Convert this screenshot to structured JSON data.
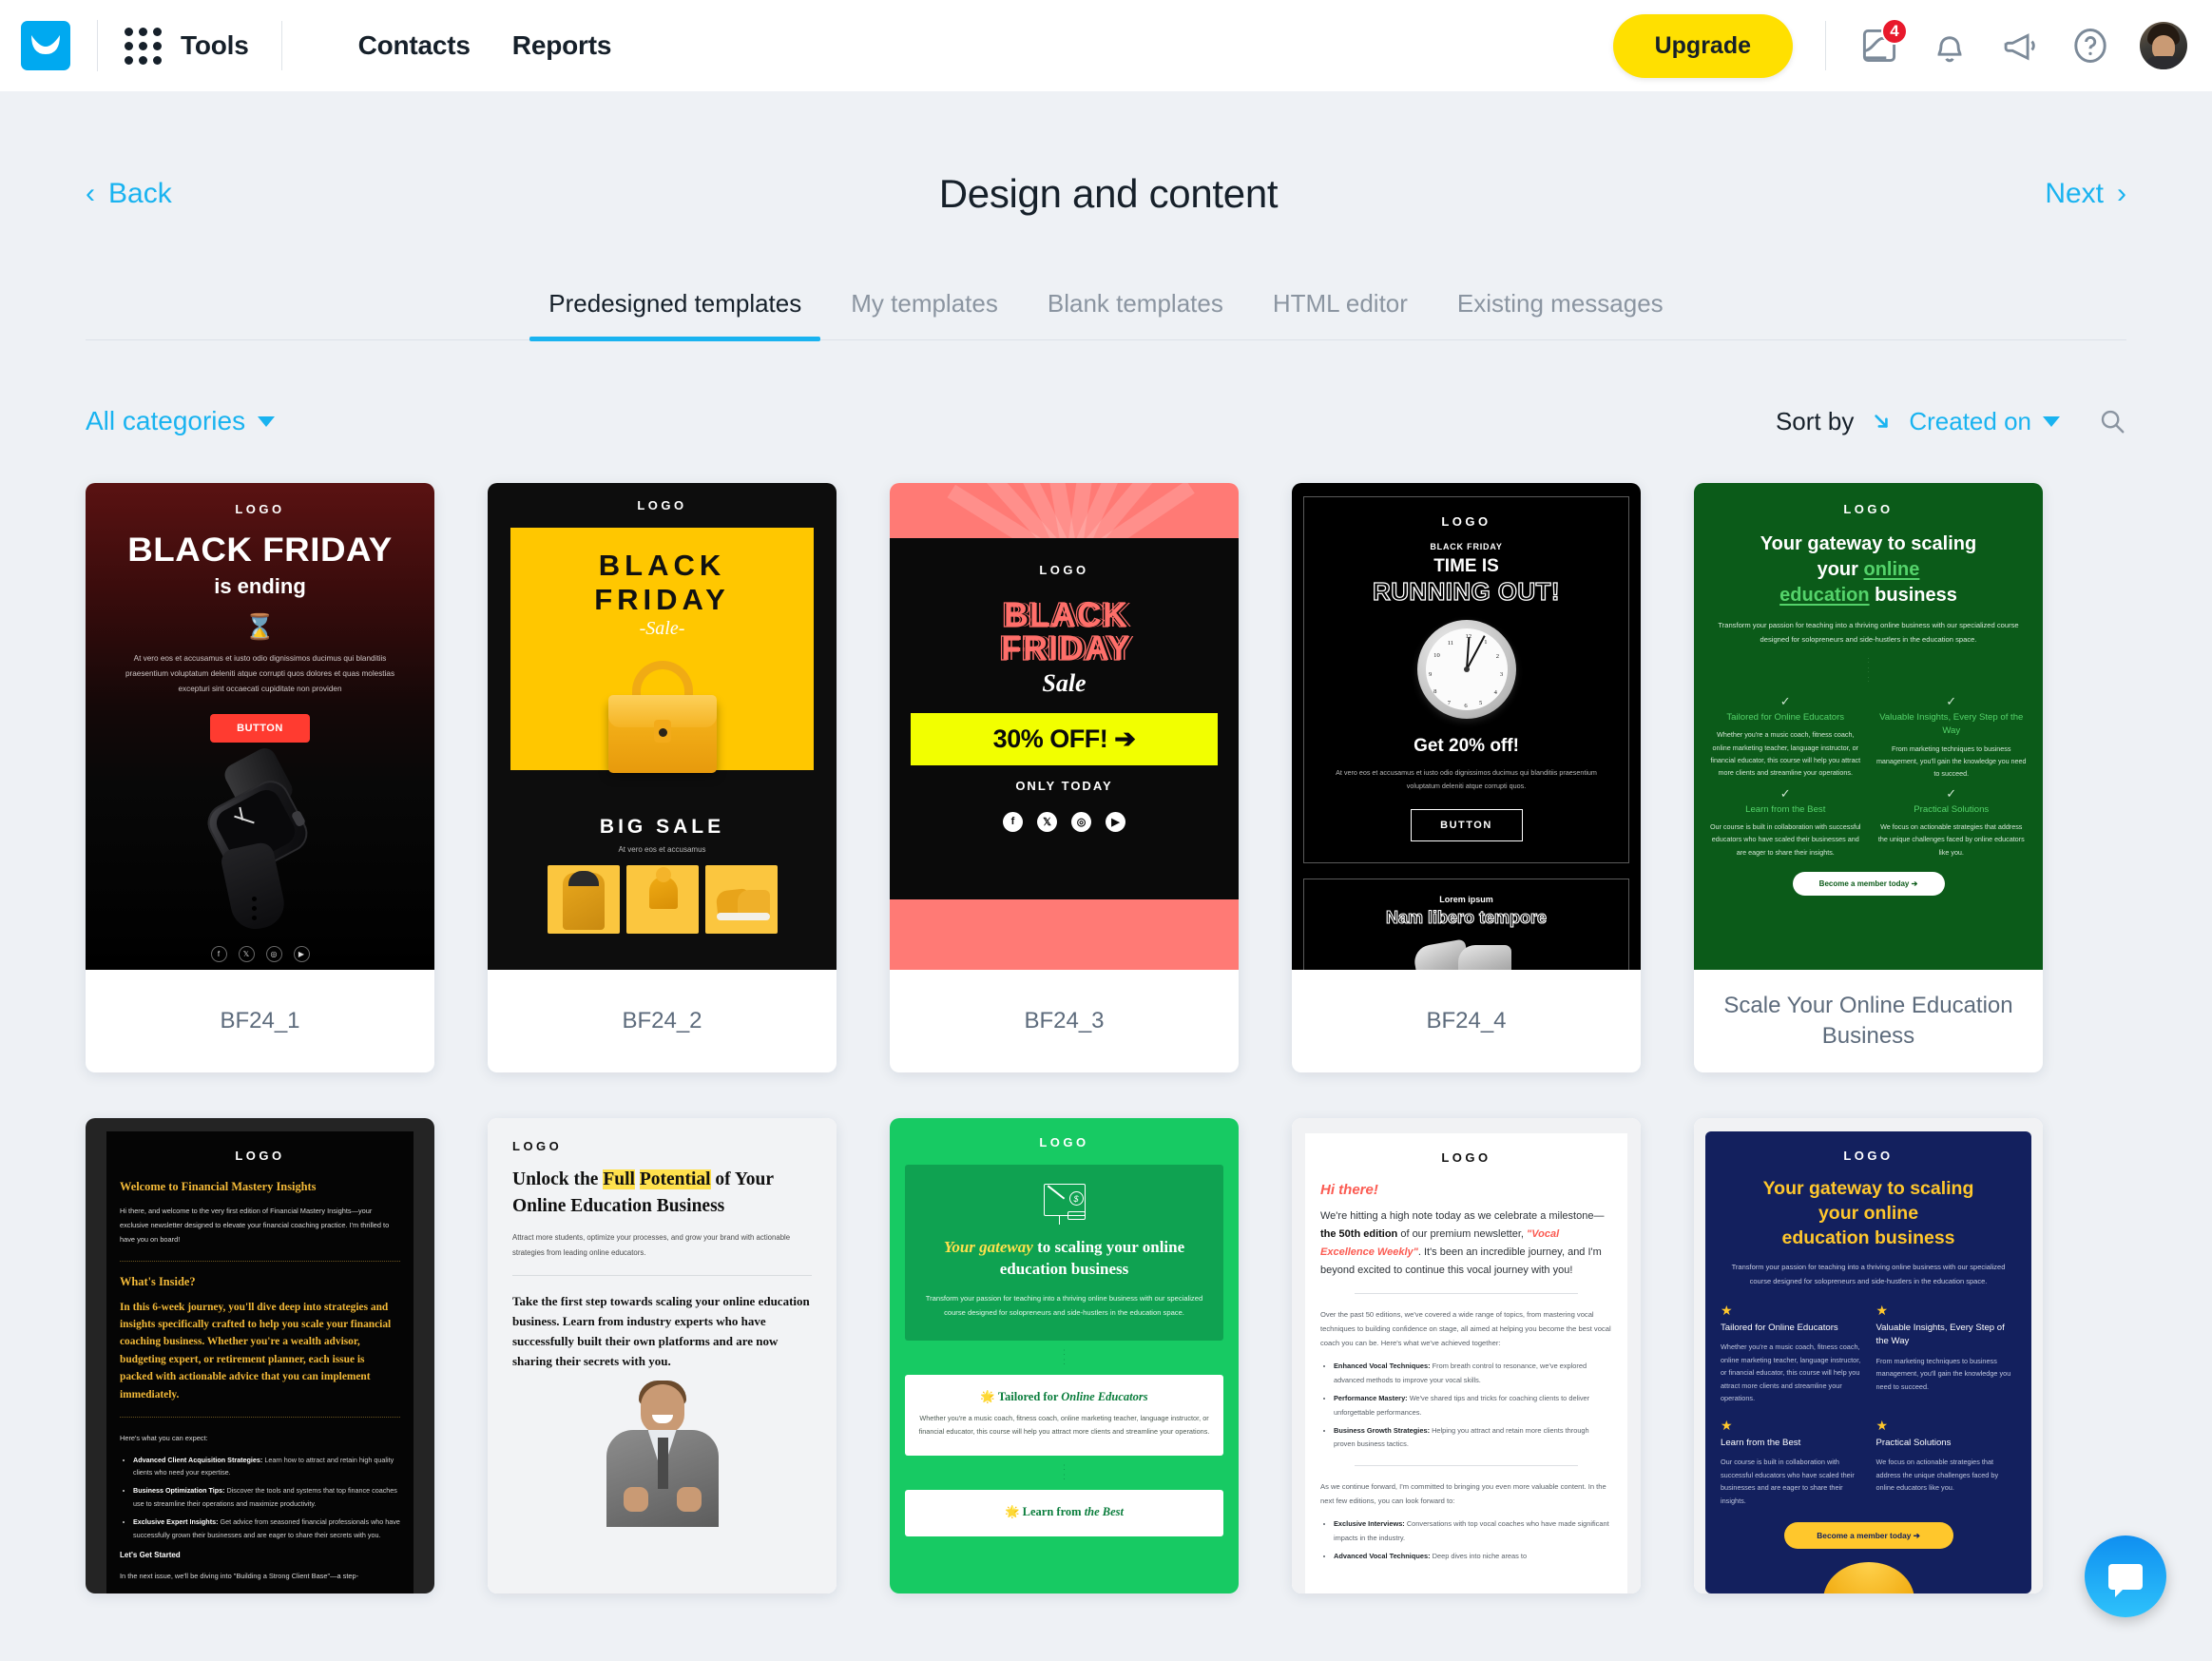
{
  "topbar": {
    "brand_icon": "getresponse-logo",
    "tools_label": "Tools",
    "nav": [
      {
        "label": "Contacts"
      },
      {
        "label": "Reports"
      }
    ],
    "upgrade_label": "Upgrade",
    "notifications_badge": "4",
    "icons": [
      "inbox-icon",
      "bell-icon",
      "megaphone-icon",
      "help-icon",
      "avatar"
    ]
  },
  "header": {
    "back_label": "Back",
    "title": "Design and content",
    "next_label": "Next"
  },
  "tabs": [
    {
      "label": "Predesigned templates",
      "active": true
    },
    {
      "label": "My templates",
      "active": false
    },
    {
      "label": "Blank templates",
      "active": false
    },
    {
      "label": "HTML editor",
      "active": false
    },
    {
      "label": "Existing messages",
      "active": false
    }
  ],
  "filters": {
    "categories_label": "All categories",
    "sort_by_label": "Sort by",
    "sort_value": "Created on",
    "search_icon": "search-icon"
  },
  "templates": [
    {
      "name": "BF24_1",
      "logo": "LOGO",
      "heading": "BLACK FRIDAY",
      "subheading": "is ending",
      "body": "At vero eos et accusamus et iusto odio dignissimos ducimus qui blanditiis praesentium voluptatum deleniti atque corrupti quos dolores et quas molestias excepturi sint occaecati cupiditate non providen",
      "button": "BUTTON",
      "socials": [
        "f",
        "𝕏",
        "◎",
        "▶"
      ]
    },
    {
      "name": "BF24_2",
      "logo": "LOGO",
      "heading_line1": "BLACK",
      "heading_line2": "FRIDAY",
      "script": "-Sale-",
      "big_sale": "BIG  SALE",
      "sub": "At vero eos et accusamus"
    },
    {
      "name": "BF24_3",
      "logo": "LOGO",
      "heading_line1": "BLACK",
      "heading_line2": "FRIDAY",
      "script": "Sale",
      "offer": "30% OFF! ➔",
      "only_today": "ONLY TODAY",
      "socials": [
        "f",
        "𝕏",
        "◎",
        "▶"
      ]
    },
    {
      "name": "BF24_4",
      "logo": "LOGO",
      "kicker": "BLACK FRIDAY",
      "heading_line1": "TIME IS",
      "heading_line2": "RUNNING OUT!",
      "offer": "Get 20% off!",
      "body": "At vero eos et accusamus et iusto odio dignissimos ducimus qui blanditiis praesentium voluptatum deleniti atque corrupti quos.",
      "button": "BUTTON",
      "panel2_kicker": "Lorem ipsum",
      "panel2_heading": "Nam libero tempore",
      "clock_numbers": [
        "12",
        "1",
        "2",
        "3",
        "4",
        "5",
        "6",
        "7",
        "8",
        "9",
        "10",
        "11"
      ]
    },
    {
      "name": "Scale Your Online Education Business",
      "logo": "LOGO",
      "heading_plain1": "Your gateway to scaling",
      "heading_plain2": "your ",
      "heading_link1": "online",
      "heading_link2": "education",
      "heading_plain3": " business",
      "lead": "Transform your passion for teaching into a thriving online business with our specialized course designed for solopreneurs and side-hustlers in the education space.",
      "features": [
        {
          "title": "Tailored for Online Educators",
          "body": "Whether you're a music coach, fitness coach, online marketing teacher, language instructor, or financial educator, this course will help you attract more clients and streamline your operations."
        },
        {
          "title": "Valuable Insights, Every Step of the Way",
          "body": "From marketing techniques to business management, you'll gain the knowledge you need to succeed."
        },
        {
          "title": "Learn from the Best",
          "body": "Our course is built in collaboration with successful educators who have scaled their businesses and are eager to share their insights."
        },
        {
          "title": "Practical Solutions",
          "body": "We focus on actionable strategies that address the unique challenges faced by online educators like you."
        }
      ],
      "cta": "Become a member today ➔"
    },
    {
      "name": "",
      "logo": "LOGO",
      "heading": "Welcome to Financial Mastery Insights",
      "intro": "Hi there, and welcome to the very first edition of Financial Mastery Insights—your exclusive newsletter designed to elevate your financial coaching practice. I'm thrilled to have you on board!",
      "whats_inside": "What's Inside?",
      "journey": "In this 6-week journey, you'll dive deep into strategies and insights specifically crafted to help you scale your financial coaching business. Whether you're a wealth advisor, budgeting expert, or retirement planner, each issue is packed with actionable advice that you can implement immediately.",
      "expect": "Here's what you can expect:",
      "bullets": [
        {
          "lead": "Advanced Client Acquisition Strategies:",
          "rest": " Learn how to attract and retain high quality clients who need your expertise."
        },
        {
          "lead": "Business Optimization Tips:",
          "rest": " Discover the tools and systems that top finance coaches use to streamline their operations and maximize productivity."
        },
        {
          "lead": "Exclusive Expert Insights:",
          "rest": " Get advice from seasoned financial professionals who have successfully grown their businesses and are eager to share their secrets with you."
        }
      ],
      "lets_get_started": "Let's Get Started",
      "next_issue": "In the next issue, we'll be diving into \"Building a Strong Client Base\"—a step-"
    },
    {
      "name": "",
      "logo": "LOGO",
      "heading_a": "Unlock the ",
      "heading_mark1": "Full",
      "heading_mark2": "Potential",
      "heading_b": " of Your Online Education Business",
      "sub": "Attract more students, optimize your processes, and grow your brand with actionable strategies from leading online educators.",
      "body": "Take the first step towards scaling your online education business. Learn from industry experts who have successfully built their own platforms and are now sharing their secrets with you."
    },
    {
      "name": "",
      "logo": "LOGO",
      "heading_italic": "Your gateway",
      "heading_rest": " to scaling your online education business",
      "lead": "Transform your passion for teaching into a thriving online business with our specialized course designed for solopreneurs and side-hustlers in the education space.",
      "card1_title_a": "Tailored for ",
      "card1_title_b": "Online Educators",
      "card1_body": "Whether you're a music coach, fitness coach, online marketing teacher, language instructor, or financial educator, this course will help you attract more clients and streamline your operations.",
      "card2_title_a": "Learn from ",
      "card2_title_b": "the Best"
    },
    {
      "name": "",
      "logo": "LOGO",
      "greeting": "Hi there!",
      "lead_a": "We're hitting a high note today as we celebrate a milestone—",
      "lead_b": "the 50th edition",
      "lead_c": " of our premium newsletter, ",
      "lead_d": "\"Vocal Excellence Weekly\"",
      "lead_e": ". It's been an incredible journey, and I'm beyond excited to continue this vocal journey with you!",
      "body": "Over the past 50 editions, we've covered a wide range of topics, from mastering vocal techniques to building confidence on stage, all aimed at helping you become the best vocal coach you can be. Here's what we've achieved together:",
      "bullets": [
        {
          "lead": "Enhanced Vocal Techniques:",
          "rest": " From breath control to resonance, we've explored advanced methods to improve your vocal skills."
        },
        {
          "lead": "Performance Mastery:",
          "rest": " We've shared tips and tricks for coaching clients to deliver unforgettable performances."
        },
        {
          "lead": "Business Growth Strategies:",
          "rest": " Helping you attract and retain more clients through proven business tactics."
        }
      ],
      "body2": "As we continue forward, I'm committed to bringing you even more valuable content. In the next few editions, you can look forward to:",
      "bullets2": [
        {
          "lead": "Exclusive Interviews:",
          "rest": " Conversations with top vocal coaches who have made significant impacts in the industry."
        },
        {
          "lead": "Advanced Vocal Techniques:",
          "rest": " Deep dives into niche areas to"
        }
      ]
    },
    {
      "name": "",
      "logo": "LOGO",
      "heading_plain1": "Your gateway to scaling",
      "heading_plain2": "your ",
      "heading_accent1": "online",
      "heading_accent2": "education",
      "heading_plain3": " business",
      "lead": "Transform your passion for teaching into a thriving online business with our specialized course designed for solopreneurs and side-hustlers in the education space.",
      "features": [
        {
          "title": "Tailored for Online Educators",
          "body": "Whether you're a music coach, fitness coach, online marketing teacher, language instructor, or financial educator, this course will help you attract more clients and streamline your operations."
        },
        {
          "title": "Valuable Insights, Every Step of the Way",
          "body": "From marketing techniques to business management, you'll gain the knowledge you need to succeed."
        },
        {
          "title": "Learn from the Best",
          "body": "Our course is built in collaboration with successful educators who have scaled their businesses and are eager to share their insights."
        },
        {
          "title": "Practical Solutions",
          "body": "We focus on actionable strategies that address the unique challenges faced by online educators like you."
        }
      ],
      "cta": "Become a member today ➔"
    }
  ],
  "chat": {
    "icon": "chat-bubble-icon"
  },
  "colors": {
    "accent_blue": "#19b3f0",
    "upgrade_yellow": "#ffe000",
    "badge_red": "#e8192c",
    "page_bg": "#eef1f5"
  }
}
